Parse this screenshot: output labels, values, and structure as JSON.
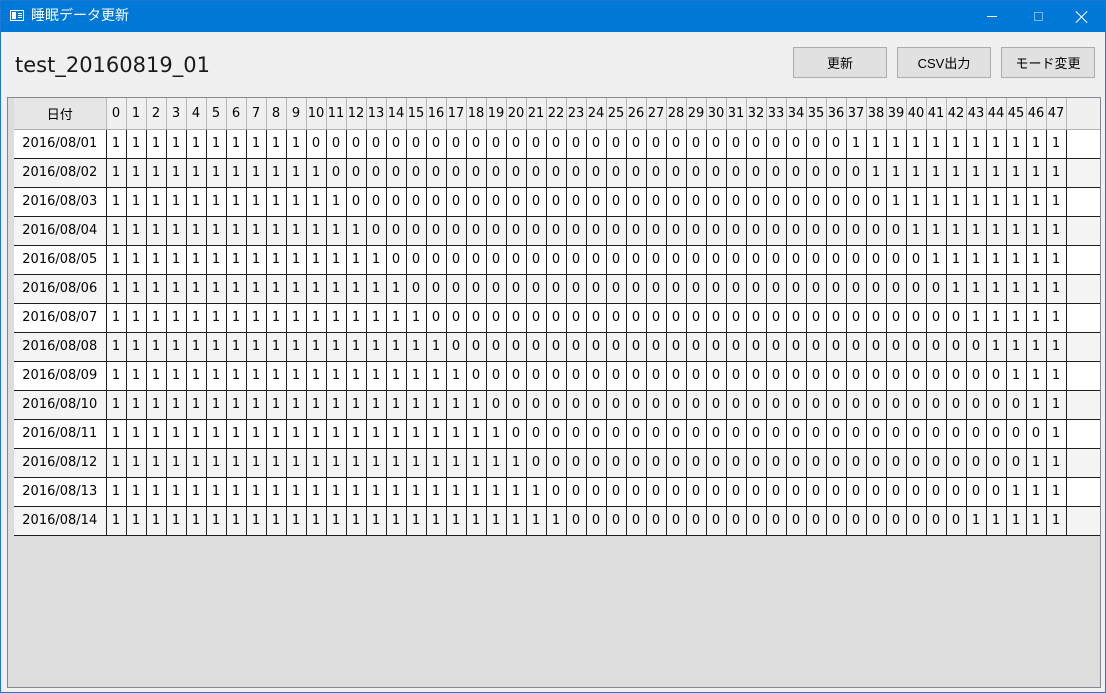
{
  "window": {
    "title": "睡眠データ更新",
    "icon": "app-window-icon"
  },
  "header": {
    "record_title": "test_20160819_01",
    "buttons": {
      "update_label": "更新",
      "csv_label": "CSV出力",
      "mode_label": "モード変更"
    }
  },
  "table": {
    "date_header": "日付",
    "slot_headers": [
      "0",
      "1",
      "2",
      "3",
      "4",
      "5",
      "6",
      "7",
      "8",
      "9",
      "10",
      "11",
      "12",
      "13",
      "14",
      "15",
      "16",
      "17",
      "18",
      "19",
      "20",
      "21",
      "22",
      "23",
      "24",
      "25",
      "26",
      "27",
      "28",
      "29",
      "30",
      "31",
      "32",
      "33",
      "34",
      "35",
      "36",
      "37",
      "38",
      "39",
      "40",
      "41",
      "42",
      "43",
      "44",
      "45",
      "46",
      "47"
    ],
    "rows": [
      {
        "date": "2016/08/01",
        "values": [
          1,
          1,
          1,
          1,
          1,
          1,
          1,
          1,
          1,
          1,
          0,
          0,
          0,
          0,
          0,
          0,
          0,
          0,
          0,
          0,
          0,
          0,
          0,
          0,
          0,
          0,
          0,
          0,
          0,
          0,
          0,
          0,
          0,
          0,
          0,
          0,
          0,
          1,
          1,
          1,
          1,
          1,
          1,
          1,
          1,
          1,
          1,
          1
        ]
      },
      {
        "date": "2016/08/02",
        "values": [
          1,
          1,
          1,
          1,
          1,
          1,
          1,
          1,
          1,
          1,
          1,
          0,
          0,
          0,
          0,
          0,
          0,
          0,
          0,
          0,
          0,
          0,
          0,
          0,
          0,
          0,
          0,
          0,
          0,
          0,
          0,
          0,
          0,
          0,
          0,
          0,
          0,
          0,
          1,
          1,
          1,
          1,
          1,
          1,
          1,
          1,
          1,
          1
        ]
      },
      {
        "date": "2016/08/03",
        "values": [
          1,
          1,
          1,
          1,
          1,
          1,
          1,
          1,
          1,
          1,
          1,
          1,
          0,
          0,
          0,
          0,
          0,
          0,
          0,
          0,
          0,
          0,
          0,
          0,
          0,
          0,
          0,
          0,
          0,
          0,
          0,
          0,
          0,
          0,
          0,
          0,
          0,
          0,
          0,
          1,
          1,
          1,
          1,
          1,
          1,
          1,
          1,
          1
        ]
      },
      {
        "date": "2016/08/04",
        "values": [
          1,
          1,
          1,
          1,
          1,
          1,
          1,
          1,
          1,
          1,
          1,
          1,
          1,
          0,
          0,
          0,
          0,
          0,
          0,
          0,
          0,
          0,
          0,
          0,
          0,
          0,
          0,
          0,
          0,
          0,
          0,
          0,
          0,
          0,
          0,
          0,
          0,
          0,
          0,
          0,
          1,
          1,
          1,
          1,
          1,
          1,
          1,
          1
        ]
      },
      {
        "date": "2016/08/05",
        "values": [
          1,
          1,
          1,
          1,
          1,
          1,
          1,
          1,
          1,
          1,
          1,
          1,
          1,
          1,
          0,
          0,
          0,
          0,
          0,
          0,
          0,
          0,
          0,
          0,
          0,
          0,
          0,
          0,
          0,
          0,
          0,
          0,
          0,
          0,
          0,
          0,
          0,
          0,
          0,
          0,
          0,
          1,
          1,
          1,
          1,
          1,
          1,
          1
        ]
      },
      {
        "date": "2016/08/06",
        "values": [
          1,
          1,
          1,
          1,
          1,
          1,
          1,
          1,
          1,
          1,
          1,
          1,
          1,
          1,
          1,
          0,
          0,
          0,
          0,
          0,
          0,
          0,
          0,
          0,
          0,
          0,
          0,
          0,
          0,
          0,
          0,
          0,
          0,
          0,
          0,
          0,
          0,
          0,
          0,
          0,
          0,
          0,
          1,
          1,
          1,
          1,
          1,
          1
        ]
      },
      {
        "date": "2016/08/07",
        "values": [
          1,
          1,
          1,
          1,
          1,
          1,
          1,
          1,
          1,
          1,
          1,
          1,
          1,
          1,
          1,
          1,
          0,
          0,
          0,
          0,
          0,
          0,
          0,
          0,
          0,
          0,
          0,
          0,
          0,
          0,
          0,
          0,
          0,
          0,
          0,
          0,
          0,
          0,
          0,
          0,
          0,
          0,
          0,
          1,
          1,
          1,
          1,
          1
        ]
      },
      {
        "date": "2016/08/08",
        "values": [
          1,
          1,
          1,
          1,
          1,
          1,
          1,
          1,
          1,
          1,
          1,
          1,
          1,
          1,
          1,
          1,
          1,
          0,
          0,
          0,
          0,
          0,
          0,
          0,
          0,
          0,
          0,
          0,
          0,
          0,
          0,
          0,
          0,
          0,
          0,
          0,
          0,
          0,
          0,
          0,
          0,
          0,
          0,
          0,
          1,
          1,
          1,
          1
        ]
      },
      {
        "date": "2016/08/09",
        "values": [
          1,
          1,
          1,
          1,
          1,
          1,
          1,
          1,
          1,
          1,
          1,
          1,
          1,
          1,
          1,
          1,
          1,
          1,
          0,
          0,
          0,
          0,
          0,
          0,
          0,
          0,
          0,
          0,
          0,
          0,
          0,
          0,
          0,
          0,
          0,
          0,
          0,
          0,
          0,
          0,
          0,
          0,
          0,
          0,
          0,
          1,
          1,
          1
        ]
      },
      {
        "date": "2016/08/10",
        "values": [
          1,
          1,
          1,
          1,
          1,
          1,
          1,
          1,
          1,
          1,
          1,
          1,
          1,
          1,
          1,
          1,
          1,
          1,
          1,
          0,
          0,
          0,
          0,
          0,
          0,
          0,
          0,
          0,
          0,
          0,
          0,
          0,
          0,
          0,
          0,
          0,
          0,
          0,
          0,
          0,
          0,
          0,
          0,
          0,
          0,
          0,
          1,
          1
        ]
      },
      {
        "date": "2016/08/11",
        "values": [
          1,
          1,
          1,
          1,
          1,
          1,
          1,
          1,
          1,
          1,
          1,
          1,
          1,
          1,
          1,
          1,
          1,
          1,
          1,
          1,
          0,
          0,
          0,
          0,
          0,
          0,
          0,
          0,
          0,
          0,
          0,
          0,
          0,
          0,
          0,
          0,
          0,
          0,
          0,
          0,
          0,
          0,
          0,
          0,
          0,
          0,
          0,
          1
        ]
      },
      {
        "date": "2016/08/12",
        "values": [
          1,
          1,
          1,
          1,
          1,
          1,
          1,
          1,
          1,
          1,
          1,
          1,
          1,
          1,
          1,
          1,
          1,
          1,
          1,
          1,
          1,
          0,
          0,
          0,
          0,
          0,
          0,
          0,
          0,
          0,
          0,
          0,
          0,
          0,
          0,
          0,
          0,
          0,
          0,
          0,
          0,
          0,
          0,
          0,
          0,
          0,
          1,
          1
        ]
      },
      {
        "date": "2016/08/13",
        "values": [
          1,
          1,
          1,
          1,
          1,
          1,
          1,
          1,
          1,
          1,
          1,
          1,
          1,
          1,
          1,
          1,
          1,
          1,
          1,
          1,
          1,
          1,
          0,
          0,
          0,
          0,
          0,
          0,
          0,
          0,
          0,
          0,
          0,
          0,
          0,
          0,
          0,
          0,
          0,
          0,
          0,
          0,
          0,
          0,
          0,
          1,
          1,
          1
        ]
      },
      {
        "date": "2016/08/14",
        "values": [
          1,
          1,
          1,
          1,
          1,
          1,
          1,
          1,
          1,
          1,
          1,
          1,
          1,
          1,
          1,
          1,
          1,
          1,
          1,
          1,
          1,
          1,
          1,
          0,
          0,
          0,
          0,
          0,
          0,
          0,
          0,
          0,
          0,
          0,
          0,
          0,
          0,
          0,
          0,
          0,
          0,
          0,
          0,
          1,
          1,
          1,
          1,
          1
        ]
      }
    ]
  },
  "colors": {
    "titlebar": "#0078d7",
    "grid_background": "#dddddd"
  }
}
